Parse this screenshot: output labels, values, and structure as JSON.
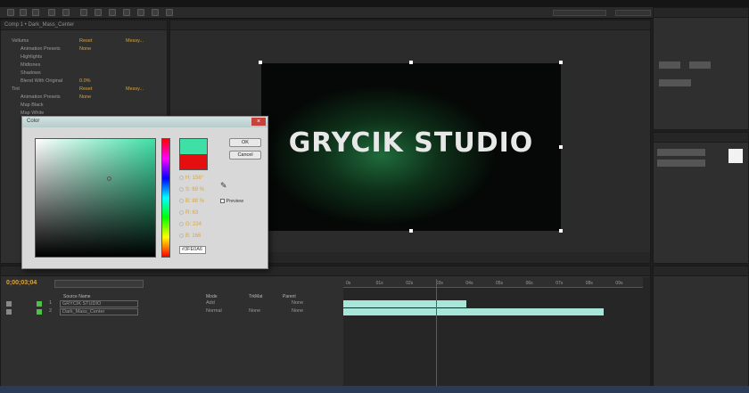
{
  "window": {
    "title": ""
  },
  "left_panel": {
    "header": "Comp 1 • Dark_Mass_Center",
    "rows": [
      {
        "label": "Vellums",
        "value": "Reset",
        "extra": "Messy...",
        "level": 0
      },
      {
        "label": "Animation Presets",
        "value": "None",
        "extra": "",
        "level": 1
      },
      {
        "label": "Highlights",
        "value": "",
        "extra": "",
        "level": 1
      },
      {
        "label": "Midtones",
        "value": "",
        "extra": "",
        "level": 1
      },
      {
        "label": "Shadows",
        "value": "",
        "extra": "",
        "level": 1
      },
      {
        "label": "Blend With Original",
        "value": "0.0%",
        "extra": "",
        "level": 1
      },
      {
        "label": "Tint",
        "value": "Reset",
        "extra": "Messy...",
        "level": 0
      },
      {
        "label": "Animation Presets",
        "value": "None",
        "extra": "",
        "level": 1
      },
      {
        "label": "Map Black",
        "value": "",
        "extra": "",
        "level": 1
      },
      {
        "label": "Map White",
        "value": "",
        "extra": "",
        "level": 1
      }
    ]
  },
  "color_picker": {
    "title": "Color",
    "ok_label": "OK",
    "cancel_label": "Cancel",
    "new_color": "#3fe0a6",
    "old_color": "#e60f0f",
    "fields": [
      "H: 156°",
      "S: 69 %",
      "B: 88 %",
      "R: 63",
      "G: 224",
      "B: 166"
    ],
    "hex_label": "#",
    "hex_value": "3FE0A6",
    "preview_label": "Preview"
  },
  "viewer": {
    "title_text": "GRYCIK STUDIO",
    "background": "#050806",
    "glow": "#1f6b3c"
  },
  "timeline": {
    "timecode": "0;00;03;04",
    "col_source": "Source Name",
    "col_mode": "Mode",
    "col_trkmat": "TrkMat",
    "col_parent": "Parent",
    "layers": [
      {
        "num": "1",
        "name": "GRYCIK STUDIO",
        "mode": "Add",
        "trkmat": "",
        "parent": "None"
      },
      {
        "num": "2",
        "name": "Dark_Mass_Center",
        "mode": "Normal",
        "trkmat": "None",
        "parent": "None"
      }
    ],
    "ruler_ticks": [
      "0s",
      "01s",
      "02s",
      "03s",
      "04s",
      "05s",
      "06s",
      "07s",
      "08s",
      "09s"
    ],
    "playhead_seconds": 3.1,
    "duration_seconds": 10,
    "bars": [
      {
        "start_seconds": 0,
        "end_seconds": 4.1
      },
      {
        "start_seconds": 0,
        "end_seconds": 8.7
      }
    ],
    "bar_color": "#a8e6da"
  },
  "colors": {
    "accent_orange": "#e0a430",
    "label_green": "#4fbf4a",
    "playhead": "#d12a2a"
  }
}
